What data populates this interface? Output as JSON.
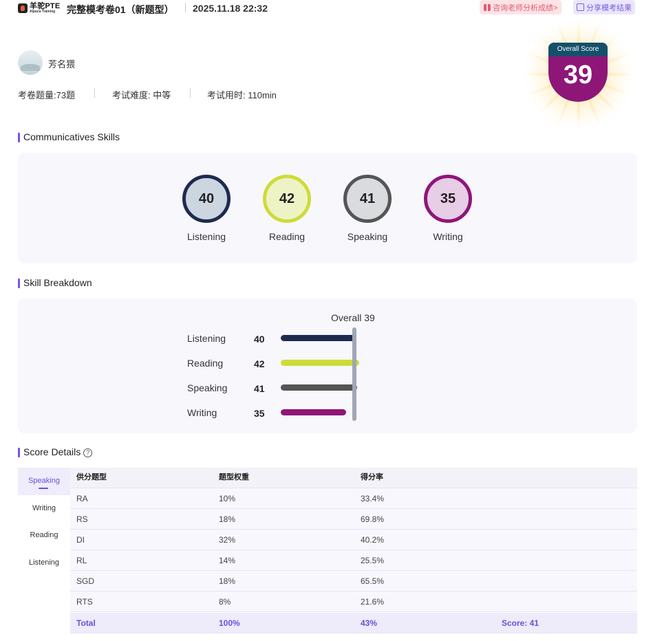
{
  "header": {
    "brand_main": "羊驼PTE",
    "brand_sub": "Alpaca Training",
    "exam_title": "完整模考卷01（新题型）",
    "exam_datetime": "2025.11.18 22:32",
    "consult_button": "咨询老师分析成绩>",
    "share_button": "分享模考结果"
  },
  "profile": {
    "username": "芳名猥",
    "question_count": "考卷题量:73题",
    "difficulty": "考试难度: 中等",
    "duration": "考试用时: 110min"
  },
  "overall": {
    "label": "Overall Score",
    "score": "39",
    "value": 39
  },
  "sections": {
    "communicative": "Communicatives Skills",
    "breakdown": "Skill Breakdown",
    "details": "Score Details"
  },
  "skills": [
    {
      "name": "Listening",
      "score": "40",
      "value": 40,
      "color": "#1e2b4f",
      "fill": "#ccd6e0"
    },
    {
      "name": "Reading",
      "score": "42",
      "value": 42,
      "color": "#cddc39",
      "fill": "#eef3c6"
    },
    {
      "name": "Speaking",
      "score": "41",
      "value": 41,
      "color": "#555555",
      "fill": "#d9dbdf"
    },
    {
      "name": "Writing",
      "score": "35",
      "value": 35,
      "color": "#8e1677",
      "fill": "#e8cde6"
    }
  ],
  "breakdown": {
    "overall_label": "Overall 39",
    "overall_value": 39,
    "scale_max": 90
  },
  "details": {
    "tabs": [
      "Speaking",
      "Writing",
      "Reading",
      "Listening"
    ],
    "active_tab": "Speaking",
    "columns": [
      "供分题型",
      "题型权重",
      "得分率"
    ],
    "rows": [
      {
        "type": "RA",
        "weight": "10%",
        "rate": "33.4%"
      },
      {
        "type": "RS",
        "weight": "18%",
        "rate": "69.8%"
      },
      {
        "type": "DI",
        "weight": "32%",
        "rate": "40.2%"
      },
      {
        "type": "RL",
        "weight": "14%",
        "rate": "25.5%"
      },
      {
        "type": "SGD",
        "weight": "18%",
        "rate": "65.5%"
      },
      {
        "type": "RTS",
        "weight": "8%",
        "rate": "21.6%"
      }
    ],
    "total": {
      "label": "Total",
      "weight": "100%",
      "rate": "43%",
      "score": "Score: 41"
    }
  }
}
